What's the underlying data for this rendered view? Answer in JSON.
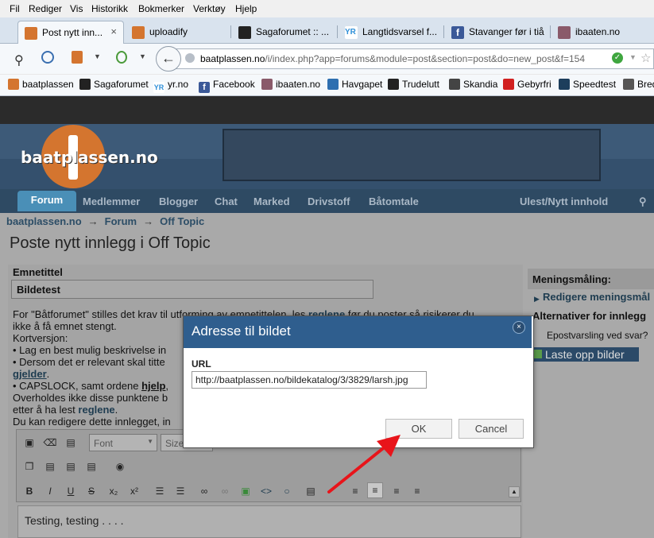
{
  "menu": [
    "Fil",
    "Rediger",
    "Vis",
    "Historikk",
    "Bokmerker",
    "Verktøy",
    "Hjelp"
  ],
  "tabs": [
    {
      "label": "Post nytt inn...",
      "active": true,
      "close": "×"
    },
    {
      "label": "uploadify"
    },
    {
      "label": "Sagaforumet :: ..."
    },
    {
      "label": "Langtidsvarsel f..."
    },
    {
      "label": "Stavanger før i tiå"
    },
    {
      "label": "ibaaten.no"
    }
  ],
  "address": {
    "host": "baatplassen.no",
    "path": "/i/index.php?app=forums&module=post&section=post&do=new_post&f=154"
  },
  "bookmarks": [
    "baatplassen",
    "Sagaforumet",
    "yr.no",
    "Facebook",
    "ibaaten.no",
    "Havgapet",
    "Trudelutt",
    "Skandia",
    "Gebyrfri",
    "Speedtest",
    "Bred"
  ],
  "site": {
    "logo": "baatplassen.no",
    "nav": [
      "Forum",
      "Medlemmer",
      "Blogger",
      "Chat",
      "Marked",
      "Drivstoff",
      "Båtomtale"
    ],
    "nav_right": "Ulest/Nytt innhold"
  },
  "breadcrumb": [
    "baatplassen.no",
    "Forum",
    "Off Topic"
  ],
  "breadcrumb_sep": "→",
  "page_title": "Poste nytt innlegg i Off Topic",
  "form": {
    "subject_label": "Emnetittel",
    "subject_value": "Bildetest",
    "rules": {
      "l1a": "For \"Båtforumet\" stilles det krav til utforming av emnetittelen, les",
      "l1link": "reglene",
      "l1b": "før du poster så risikerer du",
      "l2": "ikke å få emnet stengt.",
      "l3": "Kortversjon:",
      "l4": "• Lag en best mulig beskrivelse in",
      "l5": "• Dersom det er relevant skal titte",
      "l6link": "gjelder",
      "l6b": ".",
      "l7a": "• CAPSLOCK, samt ordene",
      "l7link": "hjelp",
      "l7b": ",",
      "l8": "Overholdes ikke disse punktene b",
      "l9a": "etter å ha lest",
      "l9link": "reglene",
      "l9b": ".",
      "l10": "Du kan redigere dette innlegget, in"
    },
    "font_placeholder": "Font",
    "size_placeholder": "Size",
    "editor_text": "Testing, testing . . . ."
  },
  "sidebar": {
    "poll_heading": "Meningsmåling:",
    "poll_link": "Redigere meningsmål",
    "alt_heading": "Alternativer for innlegg",
    "email_notify": "Epostvarsling ved svar?",
    "upload": "Laste opp bilder"
  },
  "dialog": {
    "title": "Adresse til bildet",
    "close": "×",
    "url_label": "URL",
    "url_value": "http://baatplassen.no/bildekatalog/3/3829/larsh.jpg",
    "ok_label": "OK",
    "cancel_label": "Cancel"
  },
  "colors": {
    "dialog_header": "#2f5e8e",
    "annotation_arrow": "#e8141a",
    "site_nav": "#2e4a63",
    "link": "#1e3c50"
  }
}
